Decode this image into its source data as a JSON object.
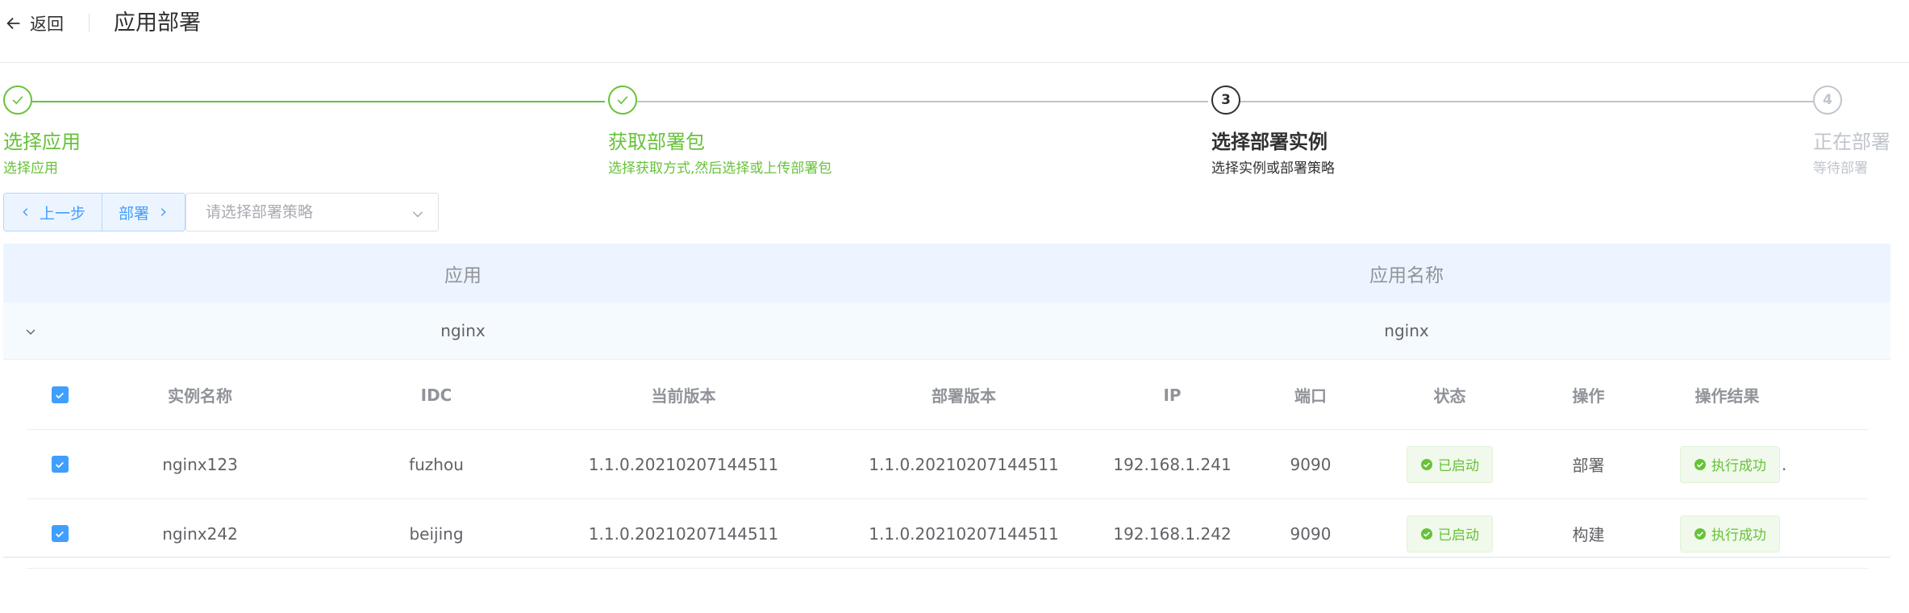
{
  "header": {
    "back_label": "返回",
    "title": "应用部署"
  },
  "steps": [
    {
      "num": "1",
      "title": "选择应用",
      "desc": "选择应用",
      "status": "done"
    },
    {
      "num": "2",
      "title": "获取部署包",
      "desc": "选择获取方式,然后选择或上传部署包",
      "status": "done"
    },
    {
      "num": "3",
      "title": "选择部署实例",
      "desc": "选择实例或部署策略",
      "status": "process"
    },
    {
      "num": "4",
      "title": "正在部署",
      "desc": "等待部署",
      "status": "wait"
    }
  ],
  "controls": {
    "prev_label": "上一步",
    "deploy_label": "部署",
    "strategy_placeholder": "请选择部署策略",
    "strategy_value": ""
  },
  "outer_table": {
    "headers": {
      "app": "应用",
      "app_name": "应用名称"
    },
    "rows": [
      {
        "app": "nginx",
        "app_name": "nginx"
      }
    ]
  },
  "instances": {
    "headers": {
      "name": "实例名称",
      "idc": "IDC",
      "current_version": "当前版本",
      "deploy_version": "部署版本",
      "ip": "IP",
      "port": "端口",
      "status": "状态",
      "operation": "操作",
      "result": "操作结果"
    },
    "rows": [
      {
        "name": "nginx123",
        "idc": "fuzhou",
        "current_version": "1.1.0.20210207144511",
        "deploy_version": "1.1.0.20210207144511",
        "ip": "192.168.1.241",
        "port": "9090",
        "status": "已启动",
        "operation": "部署",
        "result": "执行成功"
      },
      {
        "name": "nginx242",
        "idc": "beijing",
        "current_version": "1.1.0.20210207144511",
        "deploy_version": "1.1.0.20210207144511",
        "ip": "192.168.1.242",
        "port": "9090",
        "status": "已启动",
        "operation": "构建",
        "result": "执行成功"
      }
    ],
    "trailing_mark": "."
  },
  "colors": {
    "success": "#67c23a",
    "primary": "#409eff",
    "header_bg": "#ecf5ff",
    "text": "#303133",
    "muted": "#909399",
    "wait": "#c0c4cc"
  }
}
